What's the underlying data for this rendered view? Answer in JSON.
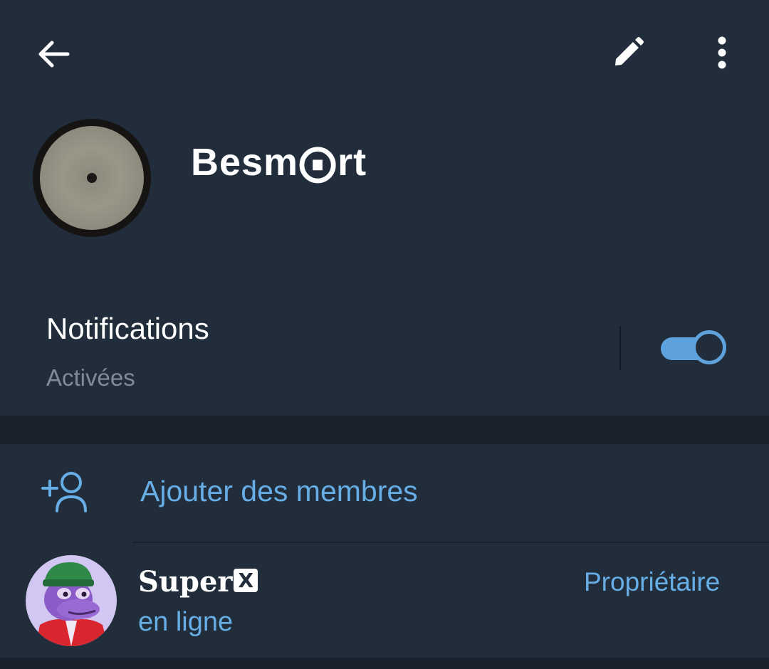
{
  "header": {
    "group_name": "Besm⨀rt",
    "back_icon": "arrow-left-icon",
    "edit_icon": "pencil-icon",
    "more_icon": "more-vertical-icon"
  },
  "notifications": {
    "title": "Notifications",
    "status": "Activées",
    "enabled": true
  },
  "members": {
    "add_label": "Ajouter des membres",
    "add_icon": "add-user-icon",
    "list": [
      {
        "name": "Super",
        "badge": "X",
        "status": "en ligne",
        "role": "Propriétaire"
      }
    ]
  },
  "colors": {
    "background": "#212d3b",
    "separator": "#18212c",
    "accent": "#5ea2dd",
    "link": "#67aee6",
    "muted": "#7f8b98"
  }
}
